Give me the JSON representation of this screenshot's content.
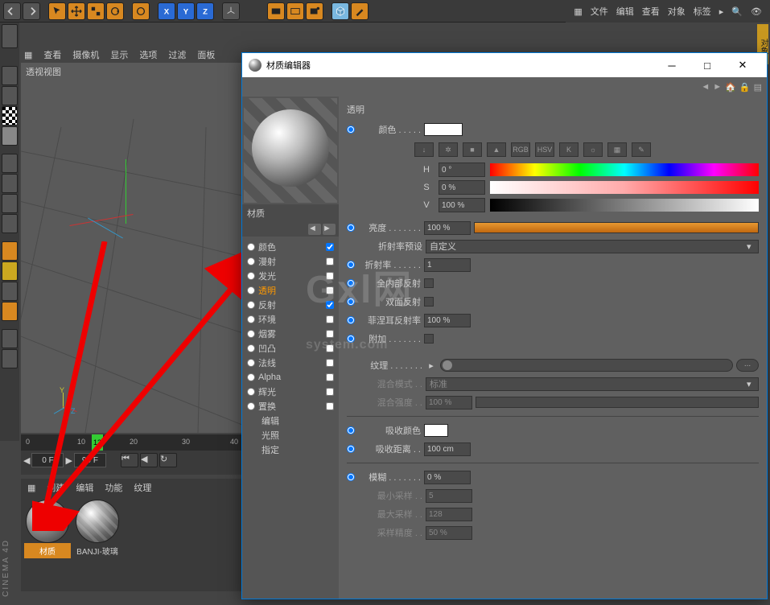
{
  "topmenu_right": {
    "file": "文件",
    "edit": "编辑",
    "view": "查看",
    "obj": "对象",
    "tag": "标签"
  },
  "vpmenu": {
    "view": "查看",
    "camera": "摄像机",
    "display": "显示",
    "option": "选项",
    "filter": "过滤",
    "panel": "面板"
  },
  "vplabel": "透视视图",
  "timeline": {
    "ticks": [
      "0",
      "10",
      "",
      "20",
      "30",
      "40"
    ],
    "current": "13",
    "t0": "0 F",
    "t1": "90 F"
  },
  "matmenu": {
    "create": "创建",
    "edit": "编辑",
    "function": "功能",
    "texture": "纹理"
  },
  "mats": [
    {
      "name": "材质"
    },
    {
      "name": "BANJI-玻璃"
    }
  ],
  "cinema": "CINEMA 4D",
  "dialog": {
    "title": "材质编辑器",
    "left_hdr": "材质",
    "channels": [
      {
        "label": "颜色",
        "checked": true,
        "sel": false
      },
      {
        "label": "漫射",
        "checked": false,
        "sel": false
      },
      {
        "label": "发光",
        "checked": false,
        "sel": false
      },
      {
        "label": "透明",
        "checked": false,
        "sel": true
      },
      {
        "label": "反射",
        "checked": true,
        "sel": false
      },
      {
        "label": "环境",
        "checked": false,
        "sel": false
      },
      {
        "label": "烟雾",
        "checked": false,
        "sel": false
      },
      {
        "label": "凹凸",
        "checked": false,
        "sel": false
      },
      {
        "label": "法线",
        "checked": false,
        "sel": false
      },
      {
        "label": "Alpha",
        "checked": false,
        "sel": false
      },
      {
        "label": "辉光",
        "checked": false,
        "sel": false
      },
      {
        "label": "置换",
        "checked": false,
        "sel": false
      }
    ],
    "channels_noedit": [
      "编辑",
      "光照",
      "指定"
    ],
    "section": "透明",
    "color_label": "颜色",
    "tex_badges": [
      "↓",
      "✲",
      "■",
      "▲",
      "RGB",
      "HSV",
      "K",
      "☼",
      "▦",
      "✎"
    ],
    "hsv": {
      "h_lbl": "H",
      "h_v": "0 °",
      "s_lbl": "S",
      "s_v": "0 %",
      "v_lbl": "V",
      "v_v": "100 %"
    },
    "brightness": {
      "lbl": "亮度",
      "v": "100 %"
    },
    "ior_preset": {
      "lbl": "折射率预设",
      "v": "自定义"
    },
    "ior": {
      "lbl": "折射率",
      "v": "1"
    },
    "tir": {
      "lbl": "全内部反射"
    },
    "bothside": {
      "lbl": "双面反射"
    },
    "fresnel": {
      "lbl": "菲涅耳反射率",
      "v": "100 %"
    },
    "additive": {
      "lbl": "附加"
    },
    "texture": {
      "lbl": "纹理"
    },
    "blendmode": {
      "lbl": "混合模式",
      "v": "标准"
    },
    "blendstrength": {
      "lbl": "混合强度",
      "v": "100 %"
    },
    "abscolor": {
      "lbl": "吸收颜色"
    },
    "absdist": {
      "lbl": "吸收距离",
      "v": "100 cm"
    },
    "blurry": {
      "lbl": "模糊",
      "v": "0 %"
    },
    "minsamp": {
      "lbl": "最小采样",
      "v": "5"
    },
    "maxsamp": {
      "lbl": "最大采样",
      "v": "128"
    },
    "accuracy": {
      "lbl": "采样精度",
      "v": "50 %"
    }
  }
}
